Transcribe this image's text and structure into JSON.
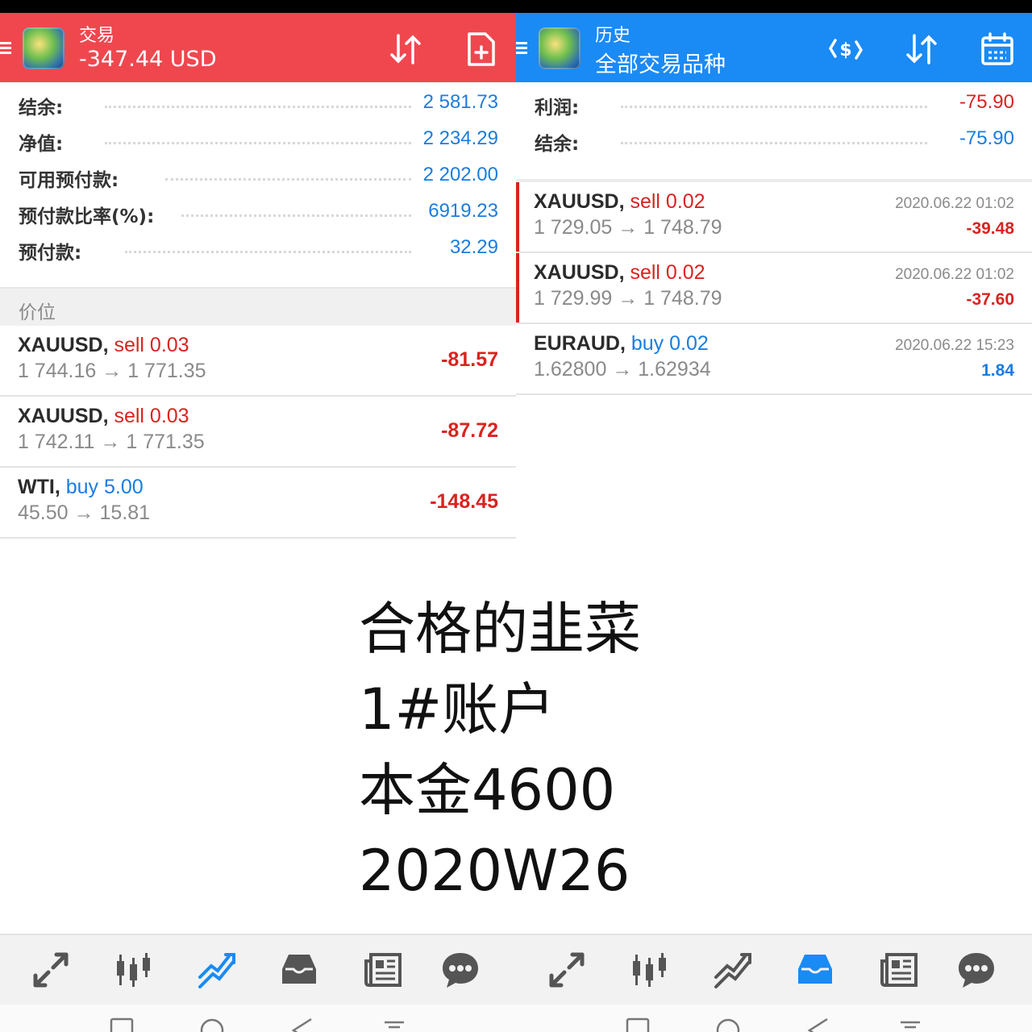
{
  "left": {
    "header": {
      "subtitle": "交易",
      "title": "-347.44 USD",
      "icons": [
        "sort-icon",
        "new-order-icon"
      ]
    },
    "summary": [
      {
        "label": "结余:",
        "value": "2 581.73"
      },
      {
        "label": "净值:",
        "value": "2 234.29"
      },
      {
        "label": "可用预付款:",
        "value": "2 202.00"
      },
      {
        "label": "预付款比率(%):",
        "value": "6919.23"
      },
      {
        "label": "预付款:",
        "value": "32.29"
      }
    ],
    "section_label": "价位",
    "positions": [
      {
        "symbol": "XAUUSD,",
        "side": "sell 0.03",
        "side_type": "sell",
        "prices": "1 744.16 → 1 771.35",
        "profit": "-81.57"
      },
      {
        "symbol": "XAUUSD,",
        "side": "sell 0.03",
        "side_type": "sell",
        "prices": "1 742.11 → 1 771.35",
        "profit": "-87.72"
      },
      {
        "symbol": "WTI,",
        "side": "buy 5.00",
        "side_type": "buy",
        "prices": "45.50 → 15.81",
        "profit": "-148.45"
      }
    ]
  },
  "right": {
    "header": {
      "subtitle": "历史",
      "title": "全部交易品种",
      "icons": [
        "currency-exchange-icon",
        "sort-icon",
        "calendar-icon"
      ]
    },
    "summary": [
      {
        "label": "利润:",
        "value": "-75.90",
        "color": "red"
      },
      {
        "label": "结余:",
        "value": "-75.90",
        "color": "blue"
      }
    ],
    "deals": [
      {
        "symbol": "XAUUSD,",
        "side": "sell 0.02",
        "side_type": "sell",
        "prices": "1 729.05 → 1 748.79",
        "time": "2020.06.22 01:02",
        "profit": "-39.48",
        "profit_color": "red",
        "marked": true
      },
      {
        "symbol": "XAUUSD,",
        "side": "sell 0.02",
        "side_type": "sell",
        "prices": "1 729.99 → 1 748.79",
        "time": "2020.06.22 01:02",
        "profit": "-37.60",
        "profit_color": "red",
        "marked": true
      },
      {
        "symbol": "EURAUD,",
        "side": "buy 0.02",
        "side_type": "buy",
        "prices": "1.62800 → 1.62934",
        "time": "2020.06.22 15:23",
        "profit": "1.84",
        "profit_color": "blue",
        "marked": false
      }
    ]
  },
  "caption": [
    "合格的韭菜",
    "1#账户",
    "本金4600",
    "2020W26"
  ],
  "bottom_nav": {
    "left": [
      {
        "icon": "quotes-icon",
        "active": false
      },
      {
        "icon": "chart-icon",
        "active": false
      },
      {
        "icon": "trade-icon",
        "active": true
      },
      {
        "icon": "history-icon",
        "active": false
      },
      {
        "icon": "news-icon",
        "active": false
      },
      {
        "icon": "chat-icon",
        "active": false
      }
    ],
    "right": [
      {
        "icon": "quotes-icon",
        "active": false
      },
      {
        "icon": "chart-icon",
        "active": false
      },
      {
        "icon": "trade-icon",
        "active": false
      },
      {
        "icon": "history-icon",
        "active": true
      },
      {
        "icon": "news-icon",
        "active": false
      },
      {
        "icon": "chat-icon",
        "active": false
      }
    ]
  },
  "colors": {
    "trade_header": "#f0474f",
    "history_header": "#1a8af5",
    "red": "#d9231f",
    "blue": "#1a7de0",
    "icon_gray": "#555555",
    "icon_active": "#1a8af5"
  }
}
